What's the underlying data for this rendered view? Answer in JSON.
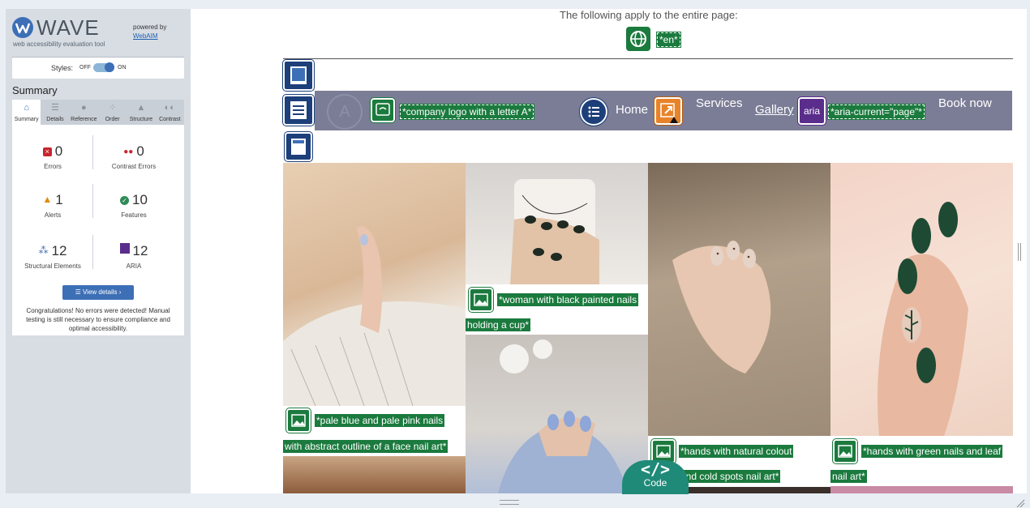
{
  "wave": {
    "title": "WAVE",
    "subtitle": "web accessibility evaluation tool",
    "powered_by": "powered by",
    "webaim": "WebAIM",
    "styles_label": "Styles:",
    "styles_off": "OFF",
    "styles_on": "ON",
    "summary_heading": "Summary",
    "tabs": [
      {
        "label": "Summary",
        "icon": "home-icon"
      },
      {
        "label": "Details",
        "icon": "list-icon"
      },
      {
        "label": "Reference",
        "icon": "info-icon"
      },
      {
        "label": "Order",
        "icon": "order-icon"
      },
      {
        "label": "Structure",
        "icon": "structure-icon"
      },
      {
        "label": "Contrast",
        "icon": "contrast-icon"
      }
    ],
    "stats": {
      "errors": {
        "value": "0",
        "label": "Errors"
      },
      "contrast": {
        "value": "0",
        "label": "Contrast Errors"
      },
      "alerts": {
        "value": "1",
        "label": "Alerts"
      },
      "features": {
        "value": "10",
        "label": "Features"
      },
      "structural": {
        "value": "12",
        "label": "Structural Elements"
      },
      "aria": {
        "value": "12",
        "label": "ARIA"
      }
    },
    "view_details": "View details ›",
    "congrats": "Congratulations! No errors were detected! Manual testing is still necessary to ensure compliance and optimal accessibility."
  },
  "page": {
    "note": "The following apply to the entire page:",
    "lang_badge": "*en*",
    "logo_letter": "A",
    "logo_alt": "*company logo with a letter A*",
    "nav": {
      "home": "Home",
      "services": "Services",
      "gallery": "Gallery",
      "aria_label": "aria",
      "aria_current": "*aria-current=\"page\"*",
      "book": "Book now"
    },
    "alts": {
      "cup_1": "*woman with black painted nails",
      "cup_2": "holding a cup*",
      "face_1": "*pale blue and pale pink nails",
      "face_2": "with abstract outline of a face nail art*",
      "natural_1": "*hands with natural colout",
      "natural_2": "and cold spots nail art*",
      "green_1": "*hands with green nails and leaf",
      "green_2": "nail art*"
    },
    "code_button": "Code",
    "code_glyph": "</>"
  },
  "colors": {
    "wave_blue": "#3d6fb6",
    "feature_green": "#1b7a3e",
    "nav_bg": "#7b7d96",
    "code_teal": "#1f8a78"
  }
}
